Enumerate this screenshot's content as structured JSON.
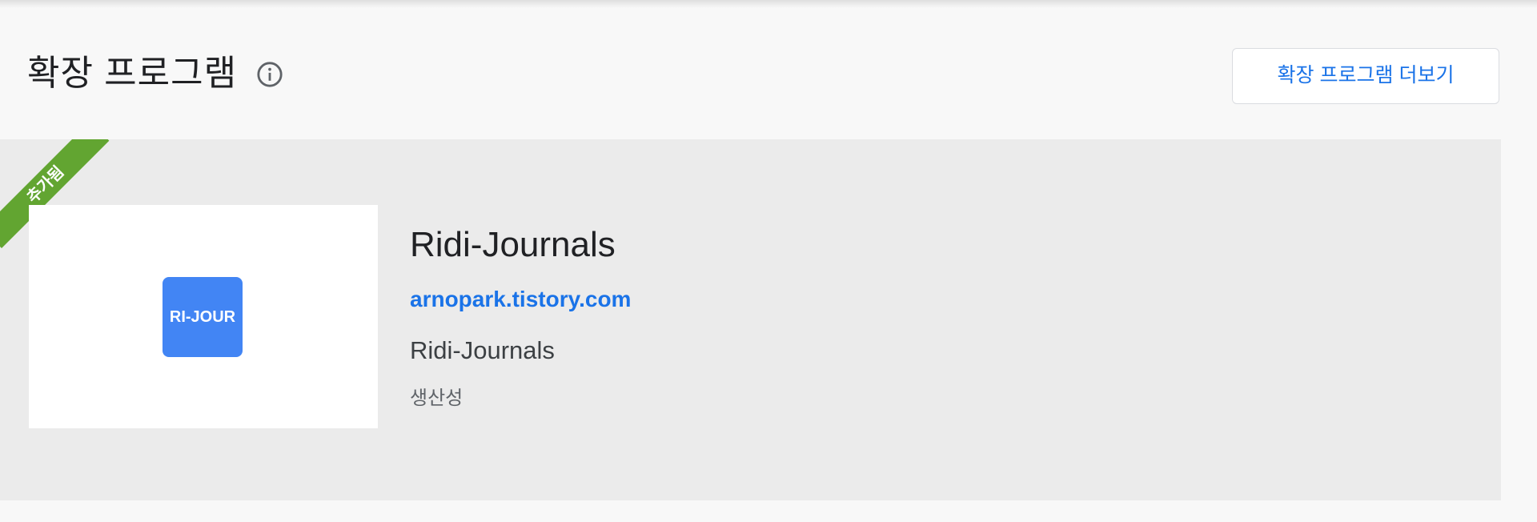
{
  "header": {
    "title": "확장 프로그램",
    "info_icon": "info-icon",
    "more_button_label": "확장 프로그램 더보기"
  },
  "extension": {
    "badge_label": "추가됨",
    "logo_text": "RI-JOUR",
    "name": "Ridi-Journals",
    "link": "arnopark.tistory.com",
    "description": "Ridi-Journals",
    "category": "생산성"
  },
  "colors": {
    "accent": "#1a73e8",
    "badge": "#62a531",
    "logo_bg": "#4285f4"
  }
}
